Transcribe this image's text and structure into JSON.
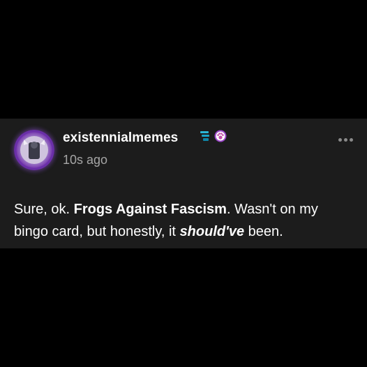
{
  "post": {
    "username": "existennialmemes",
    "timestamp": "10s ago",
    "badges": [
      "teal-bars-badge",
      "purple-paw-badge"
    ],
    "body": {
      "part1": "Sure, ok. ",
      "part2": "Frogs Against Fascism",
      "part3": ". Wasn't on my bingo card, but honestly, it ",
      "part4": "should've",
      "part5": " been."
    }
  },
  "colors": {
    "background": "#000000",
    "card": "#1c1c1c",
    "text": "#ffffff",
    "muted": "#a6a6a6",
    "avatar_glow": "#7a3fb0",
    "badge_teal": "#1aa3c7",
    "badge_purple": "#9b46c9"
  },
  "icons": {
    "more": "ellipsis-icon",
    "avatar": "avatar-image"
  }
}
